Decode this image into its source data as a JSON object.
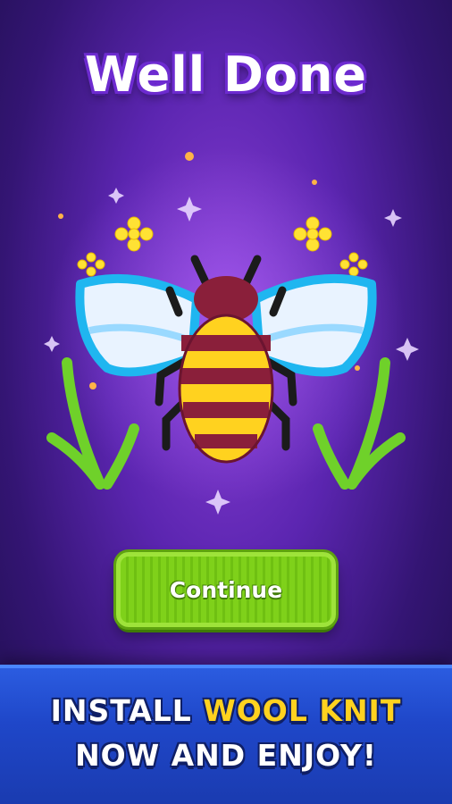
{
  "title": "Well Done",
  "continue_button": {
    "label": "Continue"
  },
  "banner": {
    "line1_prefix": "INSTALL",
    "line1_highlight": "WOOL KNIT",
    "line2": "NOW AND ENJOY!"
  },
  "artwork": {
    "subject": "knitted-bee-icon"
  },
  "colors": {
    "background": "#5b25b0",
    "button": "#7fd11a",
    "banner": "#1f47c9",
    "highlight": "#ffd21f"
  }
}
